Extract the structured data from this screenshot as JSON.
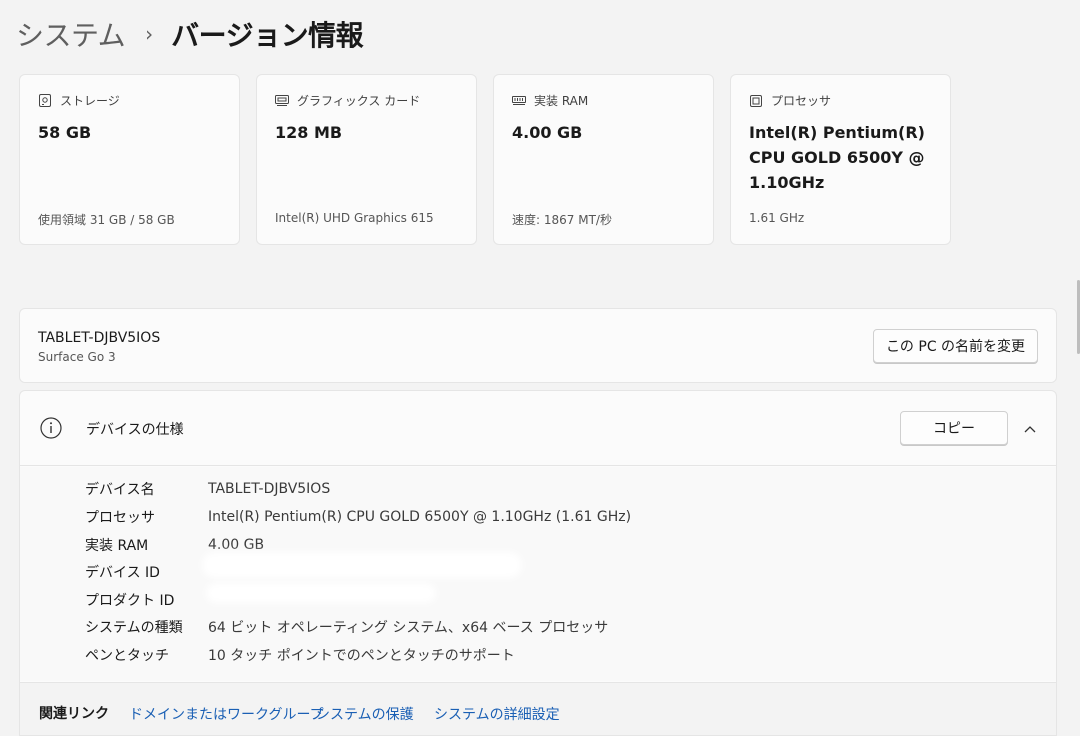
{
  "breadcrumb": {
    "parent": "システム",
    "separator": "›",
    "current": "バージョン情報"
  },
  "cards": [
    {
      "icon": "storage-icon",
      "title": "ストレージ",
      "value": "58 GB",
      "sub": "使用領域 31 GB / 58 GB"
    },
    {
      "icon": "graphics-card-icon",
      "title": "グラフィックス カード",
      "value": "128 MB",
      "sub": "Intel(R) UHD Graphics 615"
    },
    {
      "icon": "ram-icon",
      "title": "実装 RAM",
      "value": "4.00 GB",
      "sub": "速度: 1867 MT/秒"
    },
    {
      "icon": "processor-icon",
      "title": "プロセッサ",
      "value": "Intel(R) Pentium(R) CPU GOLD 6500Y @ 1.10GHz",
      "sub": "1.61 GHz"
    }
  ],
  "device": {
    "name": "TABLET-DJBV5IOS",
    "model": "Surface Go 3",
    "rename_label": "この PC の名前を変更"
  },
  "specs": {
    "title": "デバイスの仕様",
    "copy_label": "コピー",
    "rows": [
      {
        "label": "デバイス名",
        "value": "TABLET-DJBV5IOS"
      },
      {
        "label": "プロセッサ",
        "value": "Intel(R) Pentium(R) CPU GOLD 6500Y @ 1.10GHz (1.61 GHz)"
      },
      {
        "label": "実装 RAM",
        "value": "4.00 GB"
      },
      {
        "label": "デバイス ID",
        "value": ""
      },
      {
        "label": "プロダクト ID",
        "value": ""
      },
      {
        "label": "システムの種類",
        "value": "64 ビット オペレーティング システム、x64 ベース プロセッサ"
      },
      {
        "label": "ペンとタッチ",
        "value": "10 タッチ ポイントでのペンとタッチのサポート"
      }
    ]
  },
  "related_links": {
    "label": "関連リンク",
    "items": [
      "ドメインまたはワークグループ",
      "システムの保護",
      "システムの詳細設定"
    ]
  },
  "colors": {
    "accent_link": "#1a5fb4",
    "background": "#f3f3f3",
    "card": "#fbfbfb"
  }
}
